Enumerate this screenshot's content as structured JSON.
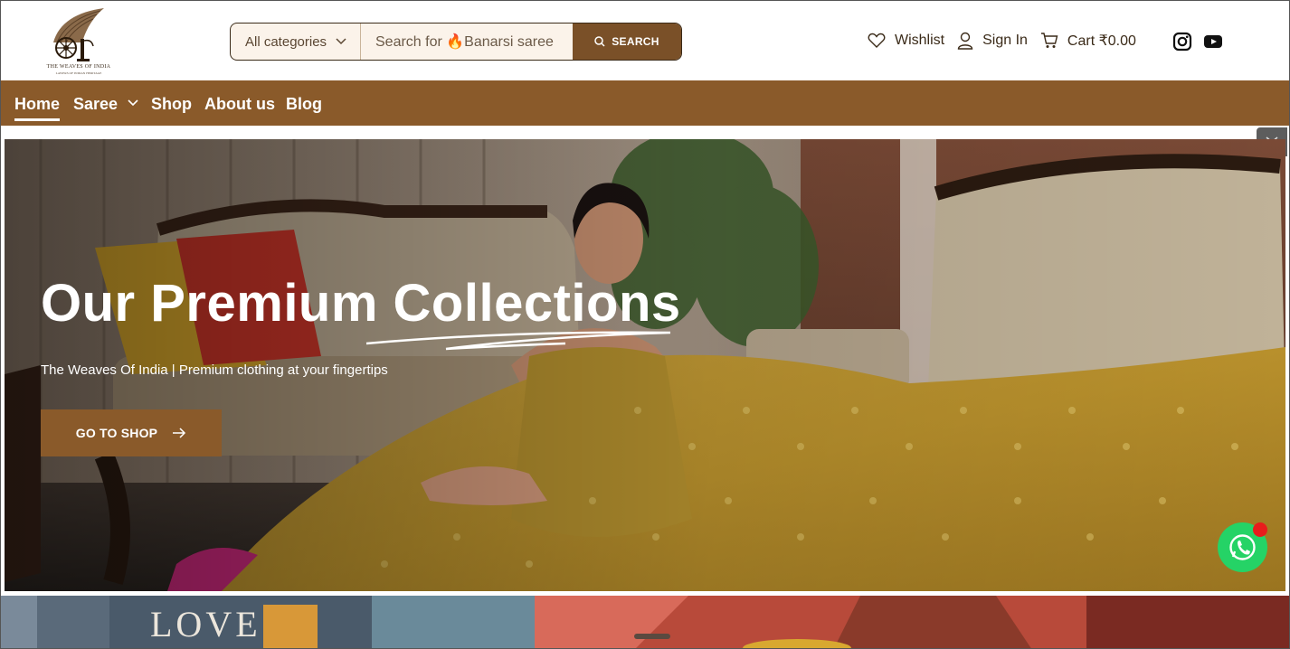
{
  "brand": {
    "logo_text": "THE WEAVES OF INDIA",
    "logo_tagline": "LAWERS OF INDIAN HERITAGE"
  },
  "search": {
    "category_label": "All categories",
    "placeholder": "Search for 🔥Banarsi saree",
    "button_label": "SEARCH"
  },
  "header_links": {
    "wishlist": "Wishlist",
    "sign_in": "Sign In",
    "cart": "Cart ₹0.00"
  },
  "nav": {
    "items": [
      {
        "label": "Home",
        "active": true
      },
      {
        "label": "Saree",
        "has_dropdown": true
      },
      {
        "label": "Shop"
      },
      {
        "label": "About us"
      },
      {
        "label": "Blog"
      }
    ]
  },
  "hero": {
    "title": "Our Premium Collections",
    "subtitle": "The Weaves Of India | Premium clothing at your fingertips",
    "cta_label": "GO TO SHOP"
  },
  "strip": {
    "book_text": "LOVE"
  },
  "colors": {
    "brand_brown": "#8a5a2a",
    "button_brown": "#7a5028",
    "whatsapp_green": "#25d366",
    "notification_red": "#e81c1c"
  },
  "icons": [
    "heart-icon",
    "user-icon",
    "cart-icon",
    "instagram-icon",
    "youtube-icon",
    "search-icon",
    "chevron-down-icon",
    "arrow-right-icon",
    "whatsapp-icon",
    "close-icon"
  ]
}
